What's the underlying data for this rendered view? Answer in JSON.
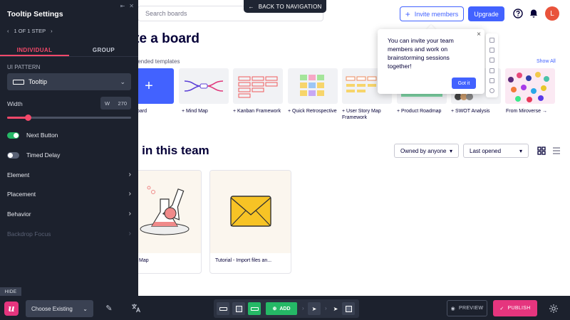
{
  "app": {
    "search_placeholder": "Search boards",
    "invite_label": "Invite members",
    "upgrade_label": "Upgrade",
    "avatar_initial": "L",
    "create_heading": "eate a board",
    "templates_label": "mmended templates",
    "show_all": "Show All",
    "templates": [
      {
        "label": "oard"
      },
      {
        "label": "+ Mind Map"
      },
      {
        "label": "+ Kanban Framework"
      },
      {
        "label": "+ Quick Retrospective"
      },
      {
        "label": "+ User Story Map Framework"
      },
      {
        "label": "+ Product Roadmap"
      },
      {
        "label": "+ SWOT Analysis"
      },
      {
        "label": "From Miroverse →"
      }
    ],
    "boards_heading": "rds in this team",
    "owner_filter": "Owned by anyone",
    "sort_filter": "Last opened",
    "boards": [
      {
        "title": "Map"
      },
      {
        "title": "Tutorial - Import files an..."
      }
    ]
  },
  "popover": {
    "text": "You can invite your team members and work on brainstorming sessions together!",
    "button": "Got it",
    "close": "×"
  },
  "back_nav": "BACK TO NAVIGATION",
  "panel": {
    "title": "Tooltip Settings",
    "step_text": "1 OF 1 STEP",
    "tabs": {
      "individual": "INDIVIDUAL",
      "group": "GROUP"
    },
    "ui_pattern_label": "UI PATTERN",
    "ui_pattern_value": "Tooltip",
    "width_label": "Width",
    "width_prefix": "W",
    "width_value": "270",
    "width_slider_fraction": 0.17,
    "next_button_label": "Next Button",
    "next_button_on": true,
    "timed_delay_label": "Timed Delay",
    "timed_delay_on": false,
    "menu": [
      {
        "label": "Element",
        "disabled": false
      },
      {
        "label": "Placement",
        "disabled": false
      },
      {
        "label": "Behavior",
        "disabled": false
      },
      {
        "label": "Backdrop Focus",
        "disabled": true
      }
    ],
    "hide_label": "HIDE"
  },
  "toolbar": {
    "logo": "u",
    "choose_existing": "Choose Existing",
    "add_label": "ADD",
    "preview_label": "PREVIEW",
    "publish_label": "PUBLISH"
  },
  "colors": {
    "accent_blue": "#4262ff",
    "panel_bg": "#1c212d",
    "accent_pink": "#f5496a",
    "toggle_on": "#25b866",
    "publish": "#e5357e"
  }
}
